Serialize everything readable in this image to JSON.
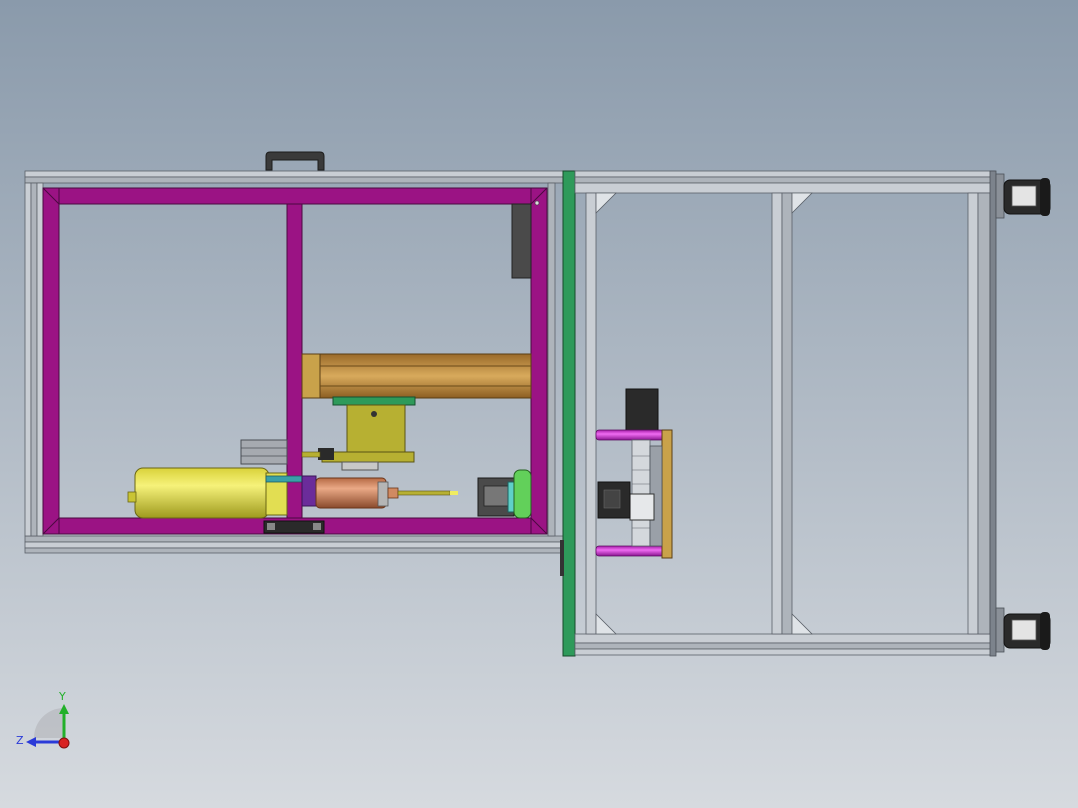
{
  "viewport": {
    "background_top": "#8a9aab",
    "background_bottom": "#d6dadf"
  },
  "colors": {
    "frame_magenta": "#9b1384",
    "aluminum": "#b8bec6",
    "aluminum_dark": "#7c838c",
    "aluminum_light": "#dfe3e7",
    "panel_green": "#2e9a5a",
    "cylinder_yellow": "#e8e458",
    "slide_olive": "#b7b032",
    "slide_tan": "#b8883e",
    "pink_rod": "#d43bd6",
    "copper": "#d08a62",
    "dark": "#2a2a2a"
  },
  "triad": {
    "y_label": "Y",
    "z_label": "Z",
    "y_color": "#22b02a",
    "z_color": "#2a3ad8",
    "x_color": "#d82222"
  }
}
